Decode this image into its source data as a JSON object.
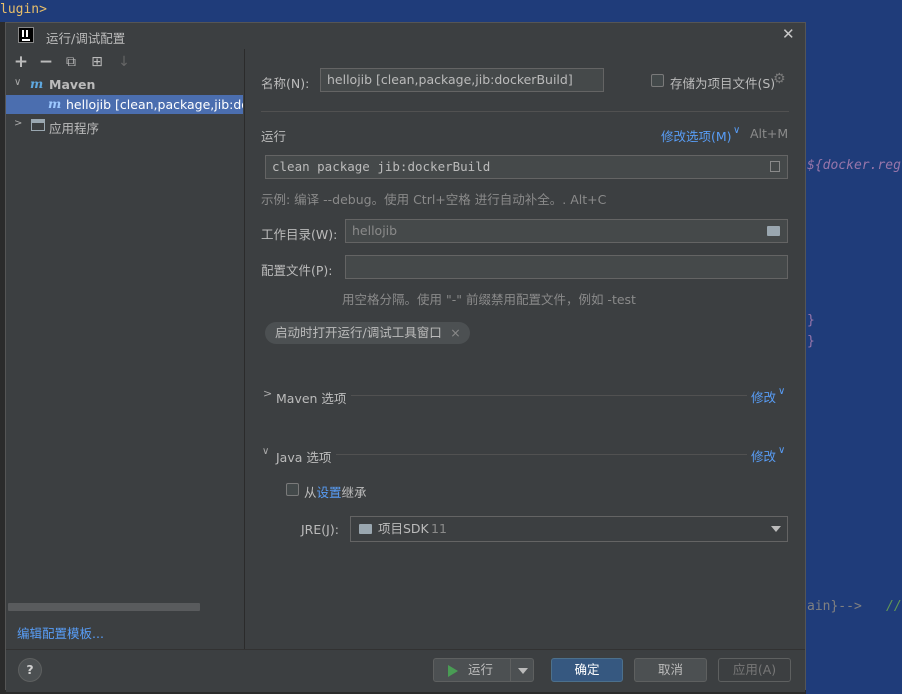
{
  "background": {
    "top_code": "lugin>",
    "code_right_1": "${docker.reg",
    "code_right_2": "}",
    "code_right_3": "}",
    "code_right_4": "ain}-->",
    "code_right_5": "//"
  },
  "dialog": {
    "title": "运行/调试配置",
    "close_glyph": "✕"
  },
  "sidebar": {
    "toolbar": [
      {
        "name": "add",
        "glyph": "+"
      },
      {
        "name": "remove",
        "glyph": "−"
      },
      {
        "name": "copy",
        "glyph": "⧉"
      },
      {
        "name": "new-folder",
        "glyph": "⊞"
      },
      {
        "name": "sort",
        "glyph": "↓"
      }
    ],
    "tree": {
      "maven_group": "Maven",
      "maven_item": "hellojib [clean,package,jib:dock",
      "app_group": "应用程序"
    },
    "edit_templates": "编辑配置模板..."
  },
  "form": {
    "name_label": "名称(N):",
    "name_value": "hellojib [clean,package,jib:dockerBuild]",
    "store_label": "存储为项目文件(S)",
    "run_section": "运行",
    "modify_options": "修改选项(M)",
    "modify_shortcut": "Alt+M",
    "command_value": "clean package jib:dockerBuild",
    "command_hint": "示例: 编译 --debug。使用 Ctrl+空格 进行自动补全。. Alt+C",
    "workdir_label": "工作目录(W):",
    "workdir_value": "hellojib",
    "profiles_label": "配置文件(P):",
    "profiles_value": "",
    "profiles_hint": "用空格分隔。使用 \"-\" 前缀禁用配置文件，例如 -test",
    "chip_label": "启动时打开运行/调试工具窗口",
    "maven_options": "Maven 选项",
    "java_options": "Java 选项",
    "modify_link": "修改",
    "inherit_prefix": "从",
    "inherit_link": "设置",
    "inherit_suffix": "继承",
    "jre_label": "JRE(J):",
    "jre_value": "项目SDK",
    "jre_version": "11"
  },
  "footer": {
    "run_button": "运行",
    "ok_button": "确定",
    "cancel_button": "取消",
    "apply_button": "应用(A)",
    "help": "?"
  },
  "colors": {
    "accent": "#589df6",
    "selection": "#4b6eaf",
    "primary_button": "#365880",
    "run_green": "#499c54"
  }
}
